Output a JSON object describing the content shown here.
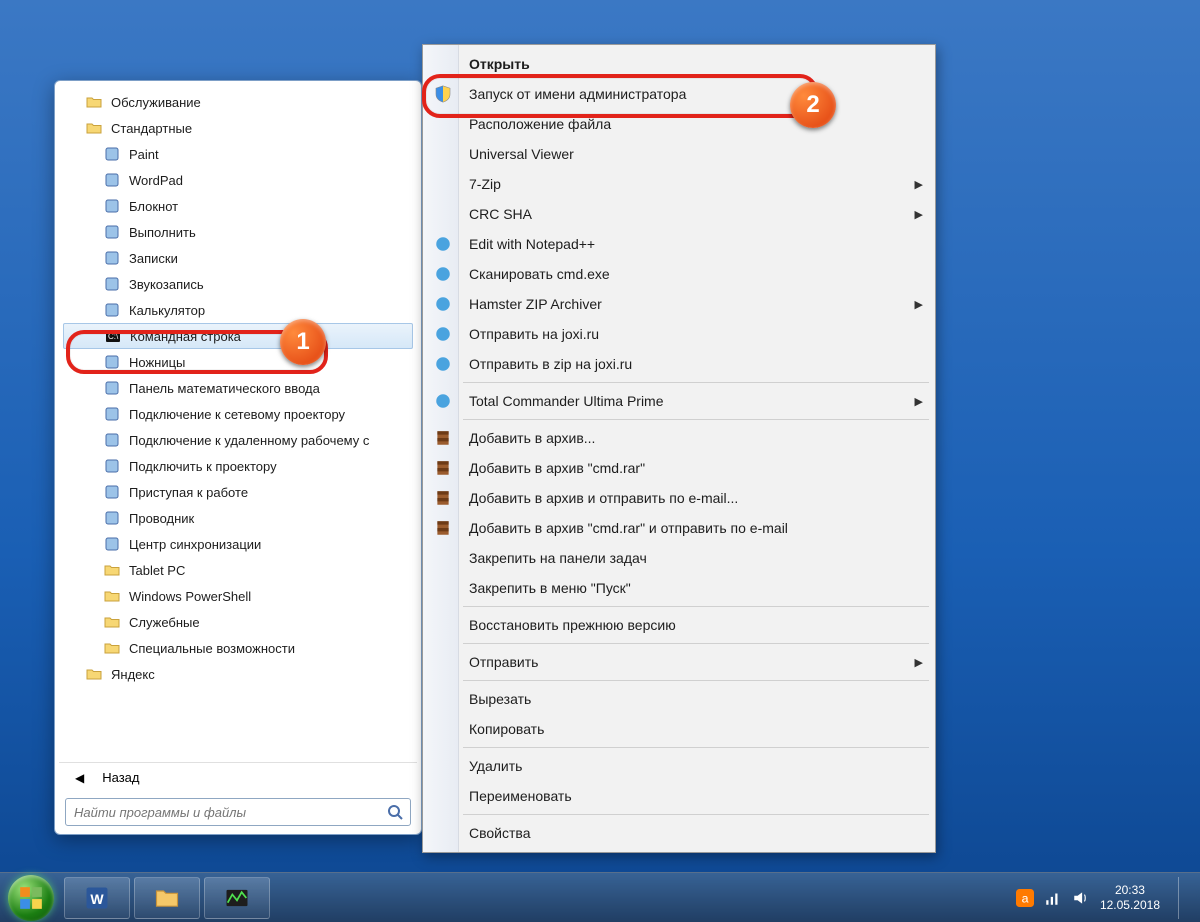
{
  "start_menu": {
    "items": [
      {
        "label": "Обслуживание",
        "icon": "folder",
        "indent": 1
      },
      {
        "label": "Стандартные",
        "icon": "folder",
        "indent": 1
      },
      {
        "label": "Paint",
        "icon": "paint",
        "indent": 2
      },
      {
        "label": "WordPad",
        "icon": "wordpad",
        "indent": 2
      },
      {
        "label": "Блокнот",
        "icon": "notepad",
        "indent": 2
      },
      {
        "label": "Выполнить",
        "icon": "run",
        "indent": 2
      },
      {
        "label": "Записки",
        "icon": "sticky",
        "indent": 2
      },
      {
        "label": "Звукозапись",
        "icon": "mic",
        "indent": 2
      },
      {
        "label": "Калькулятор",
        "icon": "calc",
        "indent": 2
      },
      {
        "label": "Командная строка",
        "icon": "cmd",
        "indent": 2,
        "selected": true
      },
      {
        "label": "Ножницы",
        "icon": "snip",
        "indent": 2
      },
      {
        "label": "Панель математического ввода",
        "icon": "math",
        "indent": 2
      },
      {
        "label": "Подключение к сетевому проектору",
        "icon": "proj",
        "indent": 2
      },
      {
        "label": "Подключение к удаленному рабочему с",
        "icon": "rdp",
        "indent": 2
      },
      {
        "label": "Подключить к проектору",
        "icon": "proj2",
        "indent": 2
      },
      {
        "label": "Приступая к работе",
        "icon": "start",
        "indent": 2
      },
      {
        "label": "Проводник",
        "icon": "explorer",
        "indent": 2
      },
      {
        "label": "Центр синхронизации",
        "icon": "sync",
        "indent": 2
      },
      {
        "label": "Tablet PC",
        "icon": "folder",
        "indent": 2
      },
      {
        "label": "Windows PowerShell",
        "icon": "folder",
        "indent": 2
      },
      {
        "label": "Служебные",
        "icon": "folder",
        "indent": 2
      },
      {
        "label": "Специальные возможности",
        "icon": "folder",
        "indent": 2
      },
      {
        "label": "Яндекс",
        "icon": "folder",
        "indent": 1
      }
    ],
    "back_label": "Назад",
    "search_placeholder": "Найти программы и файлы"
  },
  "context_menu": {
    "items": [
      {
        "label": "Открыть",
        "bold": true
      },
      {
        "label": "Запуск от имени администратора",
        "icon": "shield",
        "highlight": true
      },
      {
        "label": "Расположение файла"
      },
      {
        "label": "Universal Viewer"
      },
      {
        "label": "7-Zip",
        "submenu": true
      },
      {
        "label": "CRC SHA",
        "submenu": true
      },
      {
        "label": "Edit with Notepad++",
        "icon": "npp"
      },
      {
        "label": "Сканировать cmd.exe",
        "icon": "avast"
      },
      {
        "label": "Hamster ZIP Archiver",
        "icon": "hamster",
        "submenu": true
      },
      {
        "label": "Отправить на joxi.ru",
        "icon": "joxi"
      },
      {
        "label": "Отправить в zip на joxi.ru",
        "icon": "joxi"
      },
      {
        "sep": true
      },
      {
        "label": "Total Commander Ultima Prime",
        "icon": "tc",
        "submenu": true
      },
      {
        "sep": true
      },
      {
        "label": "Добавить в архив...",
        "icon": "rar"
      },
      {
        "label": "Добавить в архив \"cmd.rar\"",
        "icon": "rar"
      },
      {
        "label": "Добавить в архив и отправить по e-mail...",
        "icon": "rar"
      },
      {
        "label": "Добавить в архив \"cmd.rar\" и отправить по e-mail",
        "icon": "rar"
      },
      {
        "label": "Закрепить на панели задач"
      },
      {
        "label": "Закрепить в меню \"Пуск\""
      },
      {
        "sep": true
      },
      {
        "label": "Восстановить прежнюю версию"
      },
      {
        "sep": true
      },
      {
        "label": "Отправить",
        "submenu": true
      },
      {
        "sep": true
      },
      {
        "label": "Вырезать"
      },
      {
        "label": "Копировать"
      },
      {
        "sep": true
      },
      {
        "label": "Удалить"
      },
      {
        "label": "Переименовать"
      },
      {
        "sep": true
      },
      {
        "label": "Свойства"
      }
    ]
  },
  "annotations": {
    "step1": "1",
    "step2": "2"
  },
  "taskbar": {
    "time": "20:33",
    "date": "12.05.2018"
  }
}
